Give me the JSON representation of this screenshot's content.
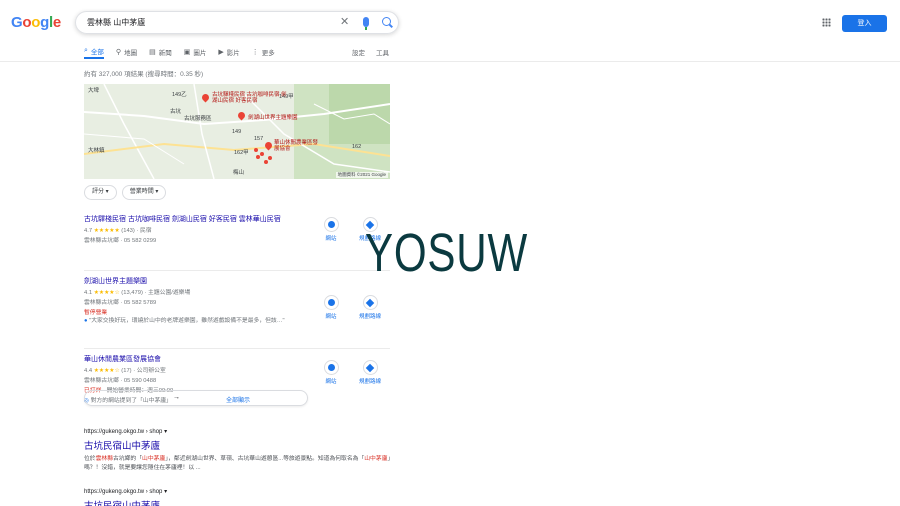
{
  "header": {
    "logo_letters": [
      "G",
      "o",
      "o",
      "g",
      "l",
      "e"
    ],
    "search_query": "雲林縣 山中茅廬",
    "signin_label": "登入"
  },
  "tabs": [
    {
      "icon": "search-icon",
      "label": "全部",
      "active": true
    },
    {
      "icon": "pin-icon",
      "label": "地圖"
    },
    {
      "icon": "news-icon",
      "label": "新聞"
    },
    {
      "icon": "image-icon",
      "label": "圖片"
    },
    {
      "icon": "video-icon",
      "label": "影片"
    },
    {
      "icon": "more-icon",
      "label": "更多"
    }
  ],
  "tools": {
    "settings": "設定",
    "tools": "工具"
  },
  "stats": "約有 327,000 項結果 (搜尋時間：0.35 秒)",
  "map": {
    "labels": [
      "大埤",
      "古坑",
      "古坑服務區",
      "大林鎮",
      "梅山",
      "149乙",
      "149",
      "162甲",
      "149甲",
      "157",
      "162"
    ],
    "pins": [
      "古坑驛棧民宿 古坑咖啡民宿 劍湖山民宿 好客民宿",
      "劍湖山世界主題樂園",
      "華山休閒農業區發展協會"
    ],
    "copyright": "地圖資料 ©2021 Google"
  },
  "filters": [
    "評分",
    "營業時間"
  ],
  "local": [
    {
      "name": "古坑驛棧民宿 古坑咖啡民宿 劍湖山民宿 好客民宿 雲林華山民宿",
      "rating": "4.7",
      "stars": "★★★★★",
      "reviews": "(143)",
      "category": "民宿",
      "address": "雲林縣古坑鄉 · 05 582 0299",
      "website": "網站",
      "directions": "規劃路線"
    },
    {
      "name": "劍湖山世界主題樂園",
      "rating": "4.1",
      "stars": "★★★★☆",
      "reviews": "(13,479)",
      "category": "主題公園/遊樂場",
      "address": "雲林縣古坑鄉 · 05 582 5789",
      "status": "暫停營業",
      "review_snippet": "\"大家交換好玩，環繞於山中的老牌遊樂園，雖然遊戲設備不是最多，但該…\"",
      "website": "網站",
      "directions": "規劃路線"
    },
    {
      "name": "華山休閒農業區發展協會",
      "rating": "4.4",
      "stars": "★★★★☆",
      "reviews": "(17)",
      "category": "公司辦公室",
      "address": "雲林縣古坑鄉 · 05 590 0488",
      "status": "已打烊",
      "hours": "開始營業時間：週三09:00",
      "web_mention": "對方的網站提到了「山中茅廬」",
      "website": "網站",
      "directions": "規劃路線"
    }
  ],
  "more_places": "全部顯示",
  "results": [
    {
      "url": "https://gukeng.okgo.tw › shop",
      "title": "古坑民宿山中茅廬",
      "snippet_pre": "位於",
      "snippet_em1": "雲林縣",
      "snippet_mid": "古坑鄉的「",
      "snippet_em2": "山中茅廬",
      "snippet_post": "」，鄰近劍湖山世界、草嶺、古坑華山遊憩區...等旅遊景點。知道為何取名為「",
      "snippet_em3": "山中茅廬",
      "snippet_end": "」嗎？！沒錯，就是要讓您隱住在茅廬裡！以 ..."
    },
    {
      "url": "https://gukeng.okgo.tw › shop",
      "title": "古坑民宿山中茅廬"
    }
  ],
  "watermark": "YOSUW",
  "colors": {
    "link": "#1a0dab",
    "accent": "#1a73e8",
    "star": "#fbbc04",
    "alert": "#d93025"
  }
}
